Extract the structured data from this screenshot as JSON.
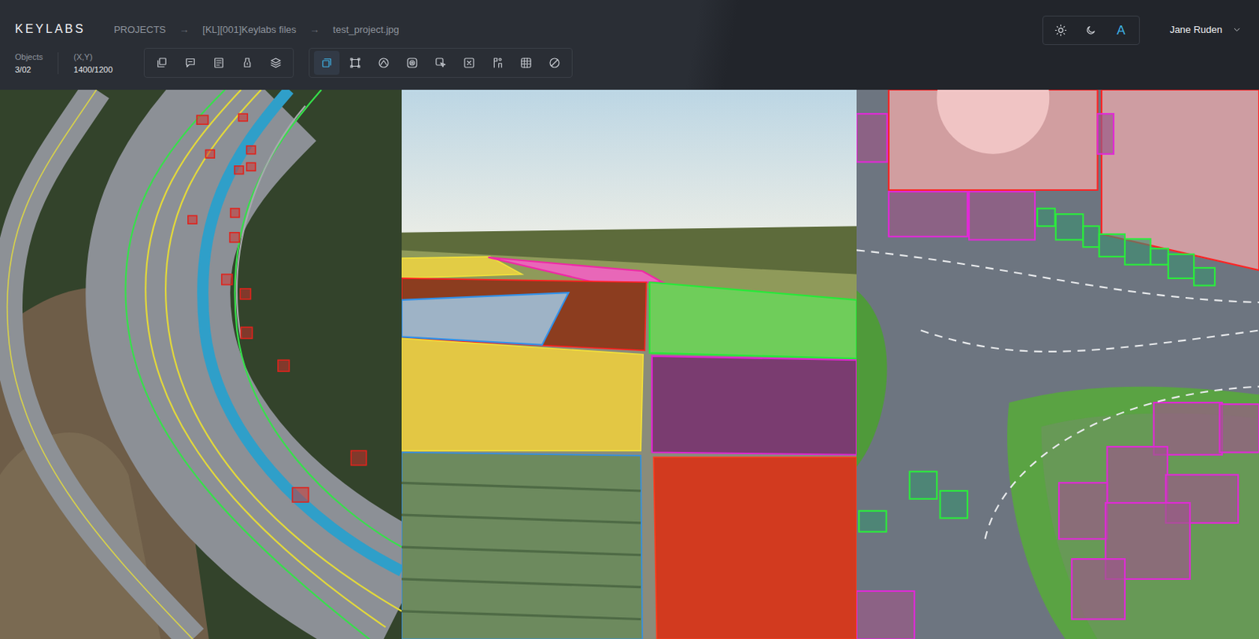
{
  "logo": "KEYLABS",
  "breadcrumb": [
    "PROJECTS",
    "→",
    "[KL][001]Keylabs files",
    "→",
    "test_project.jpg"
  ],
  "stats": [
    {
      "label": "Objects",
      "value": "3/02"
    },
    {
      "label": "(X,Y)",
      "value": "1400/1200"
    }
  ],
  "tools": {
    "panel": [
      {
        "selected": false
      },
      {
        "selected": false
      },
      {
        "selected": false
      },
      {
        "selected": false
      },
      {
        "selected": false
      }
    ],
    "drawing": [
      {
        "selected": true
      },
      {
        "selected": false
      },
      {
        "selected": false
      },
      {
        "selected": false
      },
      {
        "selected": false
      },
      {
        "selected": false
      },
      {
        "selected": false
      },
      {
        "selected": false
      },
      {
        "selected": false
      }
    ]
  },
  "theme": {
    "options": [
      {
        "selected": false
      },
      {
        "selected": false
      },
      {
        "label": "A",
        "selected": true
      }
    ]
  },
  "user": {
    "name": "Jane Ruden"
  }
}
